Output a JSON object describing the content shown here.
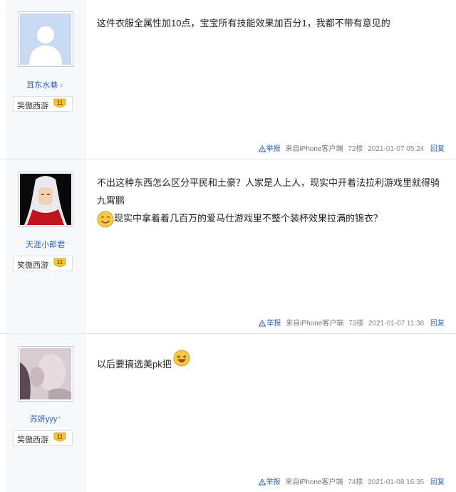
{
  "posts": [
    {
      "username": "耳东水巷",
      "gender_icon": "female-icon",
      "badge": {
        "forum": "笑傲西游",
        "level": "11"
      },
      "content": "这件衣服全属性加10点，宝宝所有技能效果加百分1，我都不带有意见的",
      "footer": {
        "report": "举报",
        "source": "来自iPhone客户端",
        "floor": "72楼",
        "time": "2021-01-07 05:24",
        "reply": "回复"
      }
    },
    {
      "username": "天涯小郎君",
      "badge": {
        "forum": "笑傲西游",
        "level": "11"
      },
      "content_line1": "不出这种东西怎么区分平民和土豪？人家是人上人，现实中开着法拉利游戏里就得骑九霄鹏",
      "content_line2": "现实中拿着着几百万的爱马仕游戏里不整个装杯效果拉满的锦衣？",
      "footer": {
        "report": "举报",
        "source": "来自iPhone客户端",
        "floor": "73楼",
        "time": "2021-01-07 11:38",
        "reply": "回复"
      }
    },
    {
      "username": "苏妍yyy",
      "username_suffix": "°",
      "badge": {
        "forum": "笑傲西游",
        "level": "11"
      },
      "content": "以后要搞选美pk把",
      "footer": {
        "report": "举报",
        "source": "来自iPhone客户端",
        "floor": "74楼",
        "time": "2021-01-08 16:35",
        "reply": "回复"
      }
    }
  ],
  "colors": {
    "link": "#2d64b3",
    "side_bg": "#f7f8fa",
    "badge_gold": "#f2c53d"
  }
}
